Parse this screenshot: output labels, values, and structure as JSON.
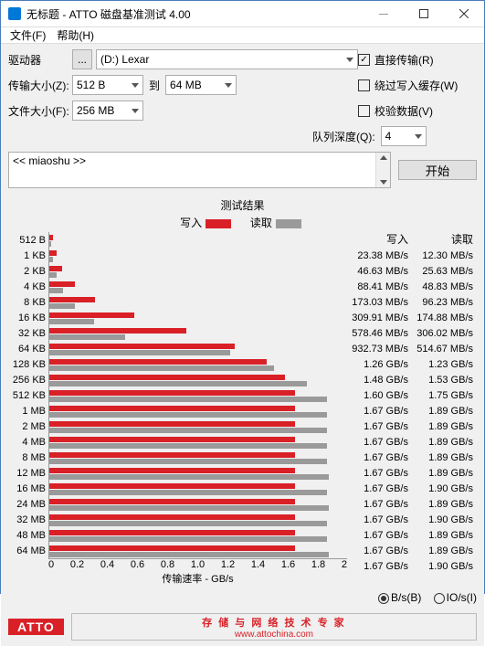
{
  "window": {
    "title": "无标题 - ATTO 磁盘基准测试 4.00"
  },
  "menu": {
    "file": "文件(F)",
    "help": "帮助(H)"
  },
  "form": {
    "drive_label": "驱动器",
    "drive_value": "(D:) Lexar",
    "xfersize_label": "传输大小(Z):",
    "xfer_from": "512 B",
    "xfer_to_label": "到",
    "xfer_to": "64 MB",
    "filesize_label": "文件大小(F):",
    "filesize_value": "256 MB",
    "direct_label": "直接传输(R)",
    "bypass_label": "绕过写入缓存(W)",
    "verify_label": "校验数据(V)",
    "depth_label": "队列深度(Q):",
    "depth_value": "4",
    "note": "<< miaoshu >>",
    "start": "开始"
  },
  "chart": {
    "title": "测试结果",
    "legend_write": "写入",
    "legend_read": "读取",
    "xlabel": "传输速率 - GB/s",
    "ticks": [
      "0",
      "0.2",
      "0.4",
      "0.6",
      "0.8",
      "1.0",
      "1.2",
      "1.4",
      "1.6",
      "1.8",
      "2"
    ],
    "write_hdr": "写入",
    "read_hdr": "读取",
    "rows": [
      {
        "label": "512 B",
        "write": "23.38 MB/s",
        "read": "12.30 MB/s",
        "w": 0.023,
        "r": 0.012
      },
      {
        "label": "1 KB",
        "write": "46.63 MB/s",
        "read": "25.63 MB/s",
        "w": 0.047,
        "r": 0.026
      },
      {
        "label": "2 KB",
        "write": "88.41 MB/s",
        "read": "48.83 MB/s",
        "w": 0.088,
        "r": 0.049
      },
      {
        "label": "4 KB",
        "write": "173.03 MB/s",
        "read": "96.23 MB/s",
        "w": 0.173,
        "r": 0.096
      },
      {
        "label": "8 KB",
        "write": "309.91 MB/s",
        "read": "174.88 MB/s",
        "w": 0.31,
        "r": 0.175
      },
      {
        "label": "16 KB",
        "write": "578.46 MB/s",
        "read": "306.02 MB/s",
        "w": 0.578,
        "r": 0.306
      },
      {
        "label": "32 KB",
        "write": "932.73 MB/s",
        "read": "514.67 MB/s",
        "w": 0.933,
        "r": 0.515
      },
      {
        "label": "64 KB",
        "write": "1.26 GB/s",
        "read": "1.23 GB/s",
        "w": 1.26,
        "r": 1.23
      },
      {
        "label": "128 KB",
        "write": "1.48 GB/s",
        "read": "1.53 GB/s",
        "w": 1.48,
        "r": 1.53
      },
      {
        "label": "256 KB",
        "write": "1.60 GB/s",
        "read": "1.75 GB/s",
        "w": 1.6,
        "r": 1.75
      },
      {
        "label": "512 KB",
        "write": "1.67 GB/s",
        "read": "1.89 GB/s",
        "w": 1.67,
        "r": 1.89
      },
      {
        "label": "1 MB",
        "write": "1.67 GB/s",
        "read": "1.89 GB/s",
        "w": 1.67,
        "r": 1.89
      },
      {
        "label": "2 MB",
        "write": "1.67 GB/s",
        "read": "1.89 GB/s",
        "w": 1.67,
        "r": 1.89
      },
      {
        "label": "4 MB",
        "write": "1.67 GB/s",
        "read": "1.89 GB/s",
        "w": 1.67,
        "r": 1.89
      },
      {
        "label": "8 MB",
        "write": "1.67 GB/s",
        "read": "1.89 GB/s",
        "w": 1.67,
        "r": 1.89
      },
      {
        "label": "12 MB",
        "write": "1.67 GB/s",
        "read": "1.90 GB/s",
        "w": 1.67,
        "r": 1.9
      },
      {
        "label": "16 MB",
        "write": "1.67 GB/s",
        "read": "1.89 GB/s",
        "w": 1.67,
        "r": 1.89
      },
      {
        "label": "24 MB",
        "write": "1.67 GB/s",
        "read": "1.90 GB/s",
        "w": 1.67,
        "r": 1.9
      },
      {
        "label": "32 MB",
        "write": "1.67 GB/s",
        "read": "1.89 GB/s",
        "w": 1.67,
        "r": 1.89
      },
      {
        "label": "48 MB",
        "write": "1.67 GB/s",
        "read": "1.89 GB/s",
        "w": 1.67,
        "r": 1.89
      },
      {
        "label": "64 MB",
        "write": "1.67 GB/s",
        "read": "1.90 GB/s",
        "w": 1.67,
        "r": 1.9
      }
    ]
  },
  "footer": {
    "bs_label": "B/s(B)",
    "ios_label": "IO/s(I)",
    "atto": "ATTO",
    "brand": "存 储 与 网 络 技 术 专 家",
    "url": "www.attochina.com"
  },
  "chart_data": {
    "type": "bar",
    "orientation": "horizontal",
    "title": "测试结果",
    "xlabel": "传输速率 - GB/s",
    "xlim": [
      0,
      2
    ],
    "categories": [
      "512 B",
      "1 KB",
      "2 KB",
      "4 KB",
      "8 KB",
      "16 KB",
      "32 KB",
      "64 KB",
      "128 KB",
      "256 KB",
      "512 KB",
      "1 MB",
      "2 MB",
      "4 MB",
      "8 MB",
      "12 MB",
      "16 MB",
      "24 MB",
      "32 MB",
      "48 MB",
      "64 MB"
    ],
    "series": [
      {
        "name": "写入",
        "color": "#d92027",
        "values": [
          0.02338,
          0.04663,
          0.08841,
          0.17303,
          0.30991,
          0.57846,
          0.93273,
          1.26,
          1.48,
          1.6,
          1.67,
          1.67,
          1.67,
          1.67,
          1.67,
          1.67,
          1.67,
          1.67,
          1.67,
          1.67,
          1.67
        ]
      },
      {
        "name": "读取",
        "color": "#9a9a9a",
        "values": [
          0.0123,
          0.02563,
          0.04883,
          0.09623,
          0.17488,
          0.30602,
          0.51467,
          1.23,
          1.53,
          1.75,
          1.89,
          1.89,
          1.89,
          1.89,
          1.89,
          1.9,
          1.89,
          1.9,
          1.89,
          1.89,
          1.9
        ]
      }
    ]
  }
}
